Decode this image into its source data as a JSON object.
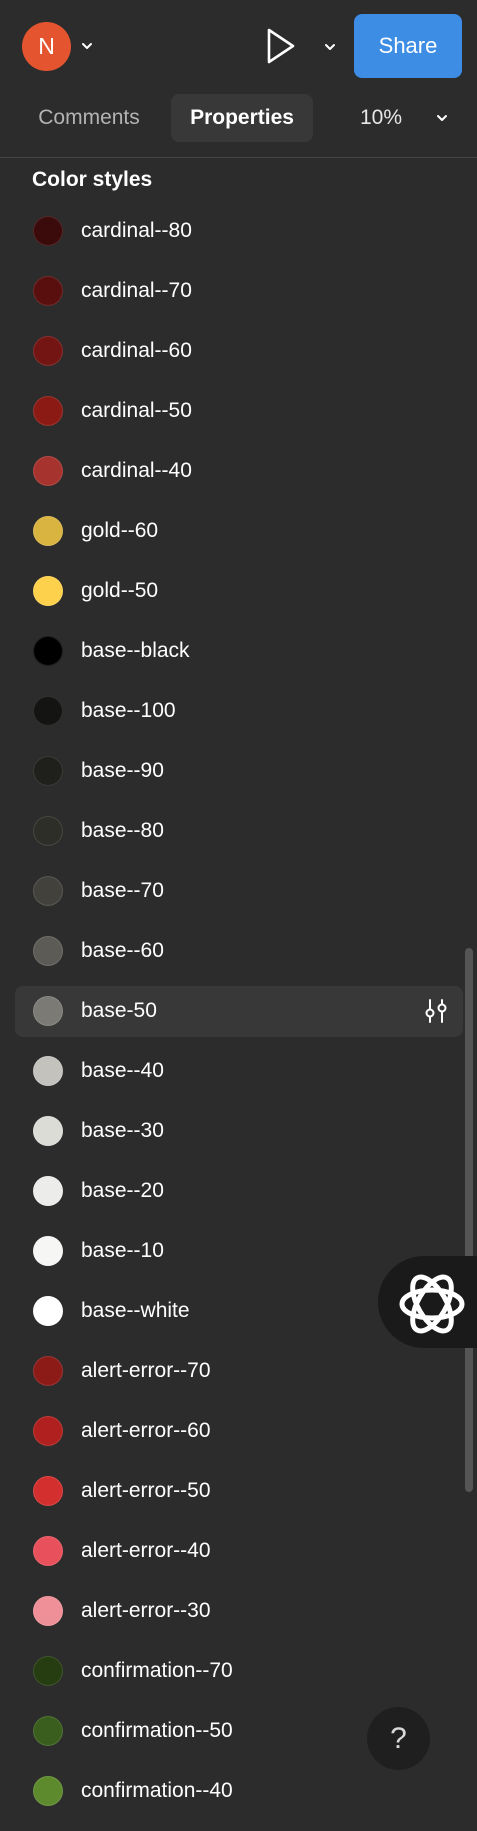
{
  "header": {
    "avatar_initial": "N",
    "share_label": "Share",
    "accent_color": "#3d8de5",
    "avatar_color": "#e4552f"
  },
  "tabs": {
    "comments": "Comments",
    "properties": "Properties",
    "active": "Properties",
    "zoom": "10%"
  },
  "section_title": "Color styles",
  "color_styles": [
    {
      "label": "cardinal--80",
      "color": "#3b0b0b"
    },
    {
      "label": "cardinal--70",
      "color": "#5a0f0f"
    },
    {
      "label": "cardinal--60",
      "color": "#731513"
    },
    {
      "label": "cardinal--50",
      "color": "#8c1a14"
    },
    {
      "label": "cardinal--40",
      "color": "#a6332d"
    },
    {
      "label": "gold--60",
      "color": "#d9b441"
    },
    {
      "label": "gold--50",
      "color": "#fdd14b"
    },
    {
      "label": "base--black",
      "color": "#000000"
    },
    {
      "label": "base--100",
      "color": "#141412"
    },
    {
      "label": "base--90",
      "color": "#1f1f1b"
    },
    {
      "label": "base--80",
      "color": "#2e2e28"
    },
    {
      "label": "base--70",
      "color": "#42413c"
    },
    {
      "label": "base--60",
      "color": "#5c5b55"
    },
    {
      "label": "base-50",
      "color": "#7b7a74",
      "selected": true
    },
    {
      "label": "base--40",
      "color": "#c3c2bd"
    },
    {
      "label": "base--30",
      "color": "#dcdcd7"
    },
    {
      "label": "base--20",
      "color": "#ececea"
    },
    {
      "label": "base--10",
      "color": "#f6f6f5"
    },
    {
      "label": "base--white",
      "color": "#ffffff"
    },
    {
      "label": "alert-error--70",
      "color": "#8c1a17"
    },
    {
      "label": "alert-error--60",
      "color": "#b0201e"
    },
    {
      "label": "alert-error--50",
      "color": "#d32f2f"
    },
    {
      "label": "alert-error--40",
      "color": "#e8505b"
    },
    {
      "label": "alert-error--30",
      "color": "#ef8f97"
    },
    {
      "label": "confirmation--70",
      "color": "#253d10"
    },
    {
      "label": "confirmation--50",
      "color": "#3a5e1d"
    },
    {
      "label": "confirmation--40",
      "color": "#5c8a2c"
    }
  ],
  "icons": {
    "play": "play-icon",
    "chevron": "chevron-down-icon",
    "adjust": "sliders-icon",
    "ai": "ai-assistant-icon",
    "help": "help-icon"
  },
  "help_label": "?"
}
